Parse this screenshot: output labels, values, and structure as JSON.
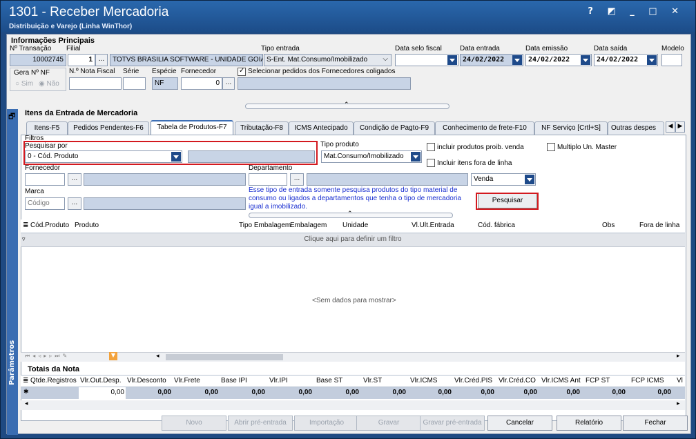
{
  "window": {
    "title": "1301 - Receber Mercadoria",
    "subtitle": "Distribuição e Varejo (Linha WinThor)",
    "buttons": "? ◩ _ □ ✕"
  },
  "main": {
    "section": "Informações Principais",
    "n_transacao_label": "Nº Transação",
    "n_transacao": "10002745",
    "filial_label": "Filial",
    "filial": "1",
    "filial_name": "TOTVS BRASILIA SOFTWARE - UNIDADE GOIÂ",
    "tipo_entrada_label": "Tipo entrada",
    "tipo_entrada": "S-Ent. Mat.Consumo/Imobilizado",
    "data_selo_label": "Data selo fiscal",
    "data_entrada_label": "Data entrada",
    "data_entrada": "24/02/2022",
    "data_emissao_label": "Data emissão",
    "data_emissao": "24/02/2022",
    "data_saida_label": "Data saída",
    "data_saida": "24/02/2022",
    "modelo_label": "Modelo",
    "gera_nf_label": "Gera Nº NF",
    "sim": "Sim",
    "nao": "Não",
    "nota_fiscal_label": "N.º Nota Fiscal",
    "serie_label": "Série",
    "especie_label": "Espécie",
    "especie": "NF",
    "fornecedor_label": "Fornecedor",
    "fornecedor": "0",
    "coligados_label": "Selecionar pedidos dos Fornecedores coligados",
    "more_btn": "..."
  },
  "itens": {
    "section": "Itens da Entrada de Mercadoria",
    "tabs": [
      "Itens-F5",
      "Pedidos Pendentes-F6",
      "Tabela de Produtos-F7",
      "Tributação-F8",
      "ICMS Antecipado",
      "Condição de Pagto-F9",
      "Conhecimento de frete-F10",
      "NF Serviço [Crtl+S]",
      "Outras despes"
    ]
  },
  "filtros": {
    "label": "Filtros",
    "pesquisar_por_label": "Pesquisar por",
    "pesquisar_por": "0 - Cód. Produto",
    "tipo_produto_label": "Tipo produto",
    "tipo_produto": "Mat.Consumo/Imobilizado",
    "chk_proib": "incluir produtos proib. venda",
    "chk_fora": "Incluir itens fora de linha",
    "chk_multiplo": "Multiplo Un. Master",
    "fornecedor_label": "Fornecedor",
    "departamento_label": "Departamento",
    "venda": "Venda",
    "marca_label": "Marca",
    "marca_placeholder": "Código",
    "info": "Esse tipo de entrada somente pesquisa produtos do tipo material de consumo ou ligados a departamentos que tenha o tipo de mercadoria igual a imobilizado.",
    "pesquisar_btn": "Pesquisar"
  },
  "grid": {
    "columns": [
      "Cód.Produto",
      "Produto",
      "Tipo Embalagem",
      "Embalagem",
      "Unidade",
      "Vl.Ult.Entrada",
      "Cód. fábrica",
      "Obs",
      "Fora de linha"
    ],
    "filter_row": "Clique aqui para definir um filtro",
    "empty": "<Sem dados para mostrar>"
  },
  "totais": {
    "label": "Totais da Nota",
    "columns": [
      "Qtde.Registros",
      "Vlr.Out.Desp.",
      "Vlr.Desconto",
      "Vlr.Frete",
      "Base IPI",
      "Vlr.IPI",
      "Base ST",
      "Vlr.ST",
      "Vlr.ICMS",
      "Vlr.Créd.PIS",
      "Vlr.Créd.CO",
      "Vlr.ICMS Ant",
      "FCP ST",
      "FCP ICMS",
      "Vl"
    ],
    "values": [
      "",
      "0,00",
      "0,00",
      "0,00",
      "0,00",
      "0,00",
      "0,00",
      "0,00",
      "0,00",
      "0,00",
      "0,00",
      "0,00",
      "0,00",
      "0,00"
    ]
  },
  "sidebar": {
    "label": "Parâmetros"
  },
  "footer": {
    "novo": "Novo",
    "abrir": "Abrir pré-entrada",
    "importacao": "Importação",
    "gravar": "Gravar",
    "gravar_pre": "Gravar pré-entrada",
    "cancelar": "Cancelar",
    "relatorio": "Relatório",
    "fechar": "Fechar"
  }
}
